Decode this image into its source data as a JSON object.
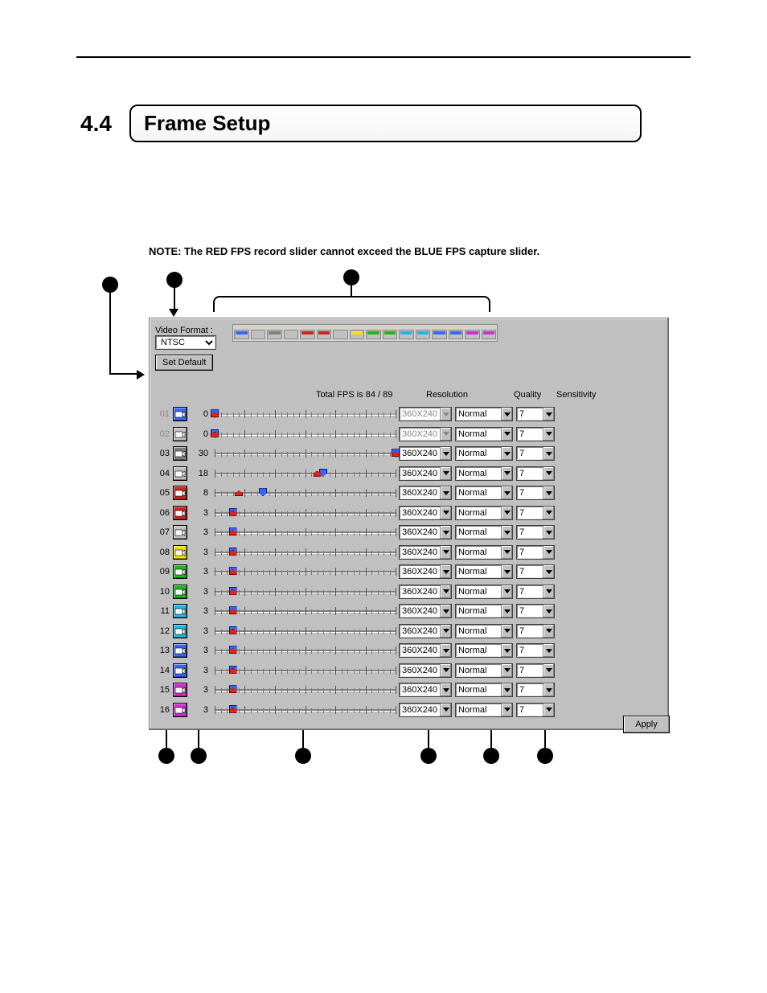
{
  "section_number": "4.4",
  "section_title": "Frame Setup",
  "note": "NOTE: The RED FPS record slider cannot exceed the BLUE FPS capture slider.",
  "panel": {
    "video_format_label": "Video Format :",
    "video_format_value": "NTSC",
    "set_default_label": "Set Default",
    "header_total": "Total FPS is 84 / 89",
    "header_resolution": "Resolution",
    "header_quality": "Quality",
    "header_sensitivity": "Sensitivity",
    "slider_max": 30,
    "channels": [
      {
        "num": "01",
        "fps": 0,
        "blue": 0,
        "red": 0,
        "res": "360X240",
        "qual": "Normal",
        "sens": "7",
        "enabled": false,
        "cam_color": "#3a66ff"
      },
      {
        "num": "02",
        "fps": 0,
        "blue": 0,
        "red": 0,
        "res": "360X240",
        "qual": "Normal",
        "sens": "7",
        "enabled": false,
        "cam_color": "#c0c0c0"
      },
      {
        "num": "03",
        "fps": 30,
        "blue": 30,
        "red": 30,
        "res": "360X240",
        "qual": "Normal",
        "sens": "7",
        "enabled": true,
        "cam_color": "#808080"
      },
      {
        "num": "04",
        "fps": 18,
        "blue": 18,
        "red": 17,
        "res": "360X240",
        "qual": "Normal",
        "sens": "7",
        "enabled": true,
        "cam_color": "#c0c0c0"
      },
      {
        "num": "05",
        "fps": 8,
        "blue": 8,
        "red": 4,
        "res": "360X240",
        "qual": "Normal",
        "sens": "7",
        "enabled": true,
        "cam_color": "#d22222"
      },
      {
        "num": "06",
        "fps": 3,
        "blue": 3,
        "red": 3,
        "res": "360X240",
        "qual": "Normal",
        "sens": "7",
        "enabled": true,
        "cam_color": "#d22222"
      },
      {
        "num": "07",
        "fps": 3,
        "blue": 3,
        "red": 3,
        "res": "360X240",
        "qual": "Normal",
        "sens": "7",
        "enabled": true,
        "cam_color": "#c0c0c0"
      },
      {
        "num": "08",
        "fps": 3,
        "blue": 3,
        "red": 3,
        "res": "360X240",
        "qual": "Normal",
        "sens": "7",
        "enabled": true,
        "cam_color": "#f3e200"
      },
      {
        "num": "09",
        "fps": 3,
        "blue": 3,
        "red": 3,
        "res": "360X240",
        "qual": "Normal",
        "sens": "7",
        "enabled": true,
        "cam_color": "#1fb81f"
      },
      {
        "num": "10",
        "fps": 3,
        "blue": 3,
        "red": 3,
        "res": "360X240",
        "qual": "Normal",
        "sens": "7",
        "enabled": true,
        "cam_color": "#1fb81f"
      },
      {
        "num": "11",
        "fps": 3,
        "blue": 3,
        "red": 3,
        "res": "360X240",
        "qual": "Normal",
        "sens": "7",
        "enabled": true,
        "cam_color": "#1fb8e4"
      },
      {
        "num": "12",
        "fps": 3,
        "blue": 3,
        "red": 3,
        "res": "360X240",
        "qual": "Normal",
        "sens": "7",
        "enabled": true,
        "cam_color": "#1fb8e4"
      },
      {
        "num": "13",
        "fps": 3,
        "blue": 3,
        "red": 3,
        "res": "360X240",
        "qual": "Normal",
        "sens": "7",
        "enabled": true,
        "cam_color": "#3a66ff"
      },
      {
        "num": "14",
        "fps": 3,
        "blue": 3,
        "red": 3,
        "res": "360X240",
        "qual": "Normal",
        "sens": "7",
        "enabled": true,
        "cam_color": "#3a66ff"
      },
      {
        "num": "15",
        "fps": 3,
        "blue": 3,
        "red": 3,
        "res": "360X240",
        "qual": "Normal",
        "sens": "7",
        "enabled": true,
        "cam_color": "#d22cd2"
      },
      {
        "num": "16",
        "fps": 3,
        "blue": 3,
        "red": 3,
        "res": "360X240",
        "qual": "Normal",
        "sens": "7",
        "enabled": true,
        "cam_color": "#d22cd2"
      }
    ],
    "apply_label": "Apply"
  }
}
